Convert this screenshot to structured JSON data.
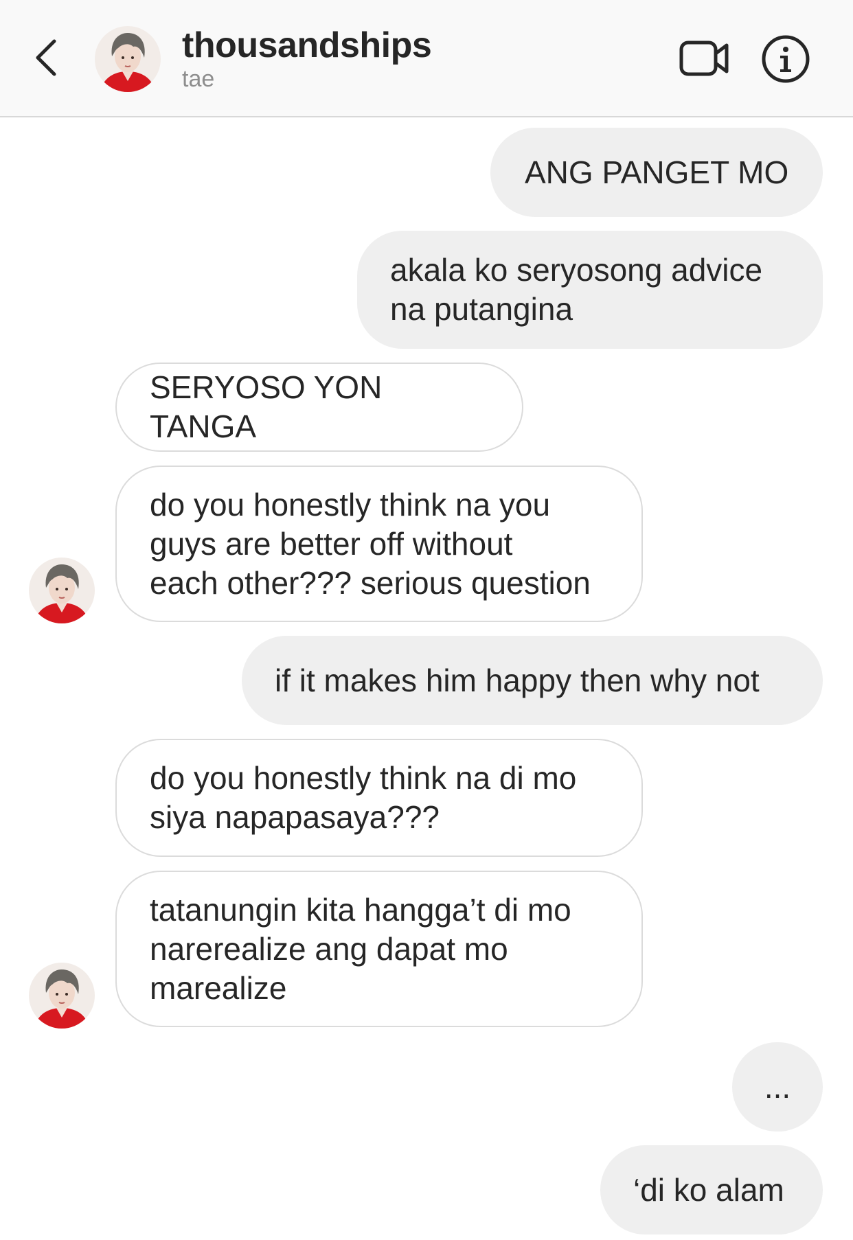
{
  "header": {
    "title": "thousandships",
    "subtitle": "tae",
    "icons": {
      "back": "chevron-left-icon",
      "video": "video-camera-icon",
      "info": "info-icon"
    }
  },
  "messages": [
    {
      "sender": "me",
      "text": "ANG PANGET MO"
    },
    {
      "sender": "me",
      "text": "akala ko seryosong advice\nna putangina"
    },
    {
      "sender": "them",
      "text": "SERYOSO YON TANGA"
    },
    {
      "sender": "them",
      "text": "do you honestly think na you\nguys are better off without\neach other??? serious question"
    },
    {
      "sender": "me",
      "text": "if it makes him happy then why not"
    },
    {
      "sender": "them",
      "text": "do you honestly think na di mo\nsiya napapasaya???"
    },
    {
      "sender": "them",
      "text": "tatanungin kita hangga’t di mo\nnarerealize ang dapat mo\nmarealize"
    },
    {
      "sender": "me",
      "text": "..."
    },
    {
      "sender": "me",
      "text": "‘di ko alam"
    }
  ],
  "colors": {
    "outgoing_bubble": "#efefef",
    "incoming_border": "#dbdbdb",
    "header_bg": "#f9f9f9",
    "subtitle": "#8e8e8e"
  }
}
